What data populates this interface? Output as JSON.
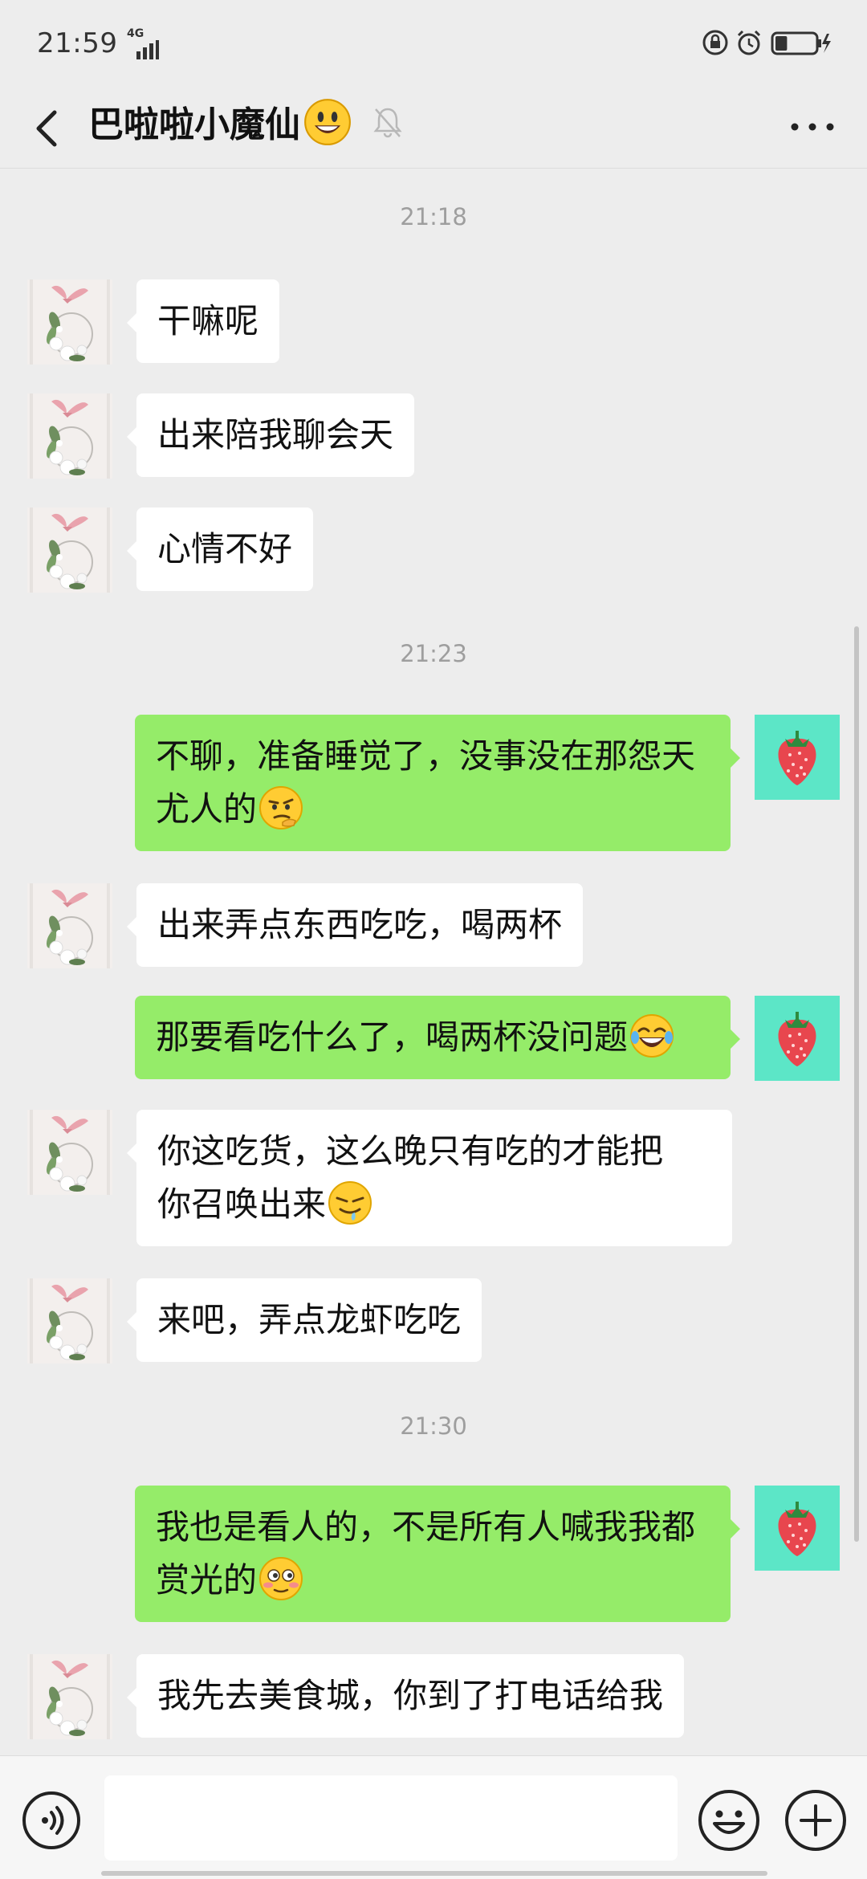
{
  "status_bar": {
    "time": "21:59",
    "network": "4G",
    "battery_level": 0.3
  },
  "header": {
    "title": "巴啦啦小魔仙",
    "title_emoji": "smiley-emoji",
    "muted": true
  },
  "messages": [
    {
      "type": "time",
      "text": "21:18"
    },
    {
      "type": "in",
      "text": "干嘛呢"
    },
    {
      "type": "in",
      "text": "出来陪我聊会天"
    },
    {
      "type": "in",
      "text": "心情不好"
    },
    {
      "type": "time",
      "text": "21:23"
    },
    {
      "type": "out",
      "line1": "不聊，准备睡觉了，没事没在那怨天",
      "line2": "尤人的",
      "emoji": "thinking-emoji"
    },
    {
      "type": "in",
      "text": "出来弄点东西吃吃，喝两杯"
    },
    {
      "type": "out",
      "text": "那要看吃什么了，喝两杯没问题",
      "emoji": "laugh-tears-emoji"
    },
    {
      "type": "in",
      "line1": "你这吃货，这么晚只有吃的才能把",
      "line2": "你召唤出来",
      "emoji": "drool-emoji"
    },
    {
      "type": "in",
      "text": "来吧，弄点龙虾吃吃"
    },
    {
      "type": "time",
      "text": "21:30"
    },
    {
      "type": "out",
      "line1": "我也是看人的，不是所有人喊我我都",
      "line2": "赏光的",
      "emoji": "flushed-emoji"
    },
    {
      "type": "in",
      "text": "我先去美食城，你到了打电话给我"
    }
  ],
  "input": {
    "value": "",
    "placeholder": ""
  },
  "icons": {
    "left_avatar": "flower-wreath-avatar",
    "right_avatar": "strawberry-avatar"
  },
  "colors": {
    "background": "#ededed",
    "outgoing_bubble": "#95ec69",
    "incoming_bubble": "#ffffff",
    "self_avatar_bg": "#5ce6c7"
  }
}
